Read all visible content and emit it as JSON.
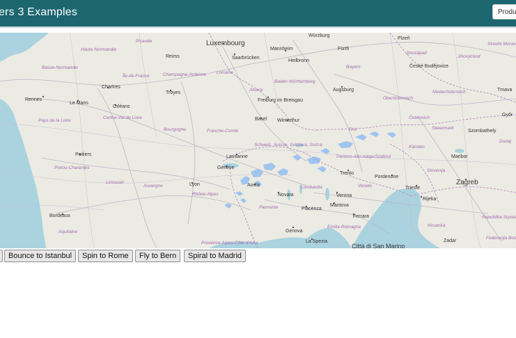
{
  "header": {
    "title": "ers 3 Examples",
    "products_button": "Produ"
  },
  "map": {
    "cities": [
      "Luxembourg",
      "Würzburg",
      "Plzeň",
      "Mannheim",
      "Fürth",
      "Reims",
      "Saarbrücken",
      "Heilbronn",
      "České Budějovice",
      "Chartres",
      "Troyes",
      "Augsburg",
      "Rennes",
      "Le Mans",
      "Orléans",
      "Freiburg im Breisgau",
      "Basel",
      "Winterthur",
      "Győr",
      "Szombathely",
      "Poitiers",
      "Lausanne",
      "Genève",
      "Maribor",
      "Lyon",
      "Aosta",
      "Trento",
      "Pordenone",
      "Zagreb",
      "Trieste",
      "Rijeka",
      "Novara",
      "Verona",
      "Piacenza",
      "Mantova",
      "Bordeaux",
      "Ferrara",
      "Genova",
      "La Spezia",
      "Città di San Marino",
      "Zadar",
      "Tmava"
    ],
    "regions": [
      "Haute-Normandie",
      "Picardie",
      "Basse-Normandie",
      "Île-de-France",
      "Champagne-Ardenne",
      "Lorraine",
      "Alsace",
      "Baden-Württemberg",
      "Bayern",
      "Jihozápad",
      "Jihovýchod",
      "Pays de la Loire",
      "Centre-Val de Loire",
      "Bourgogne",
      "Franche-Comté",
      "Oberösterreich",
      "Niederösterreich",
      "Österreich",
      "Steiermark",
      "Tirol",
      "Kärnten",
      "Schweiz, Suisse, Svizzera, Svizra",
      "Trentino-Alto Adige/Südtirol",
      "Poitou-Charentes",
      "Limousin",
      "Auvergne",
      "Rhône-Alpes",
      "Lombardia",
      "Veneto",
      "Slovenija",
      "Piemonte",
      "Emilia-Romagna",
      "Hrvatska",
      "Aquitaine",
      "Provence-Alpes-Côte d'Azur",
      "Republika Srpska",
      "Federacija Bosne i Hercegovine",
      "Stredni Morava",
      "Dunaj"
    ]
  },
  "buttons": {
    "bounce": "Bounce to Istanbul",
    "spin": "Spin to Rome",
    "fly": "Fly to Bern",
    "spiral": "Spiral to Madrid"
  },
  "colors": {
    "header": "#1c6670",
    "sea": "#aad3df",
    "land": "#ecebe3",
    "glacier": "#9fc4f0"
  }
}
